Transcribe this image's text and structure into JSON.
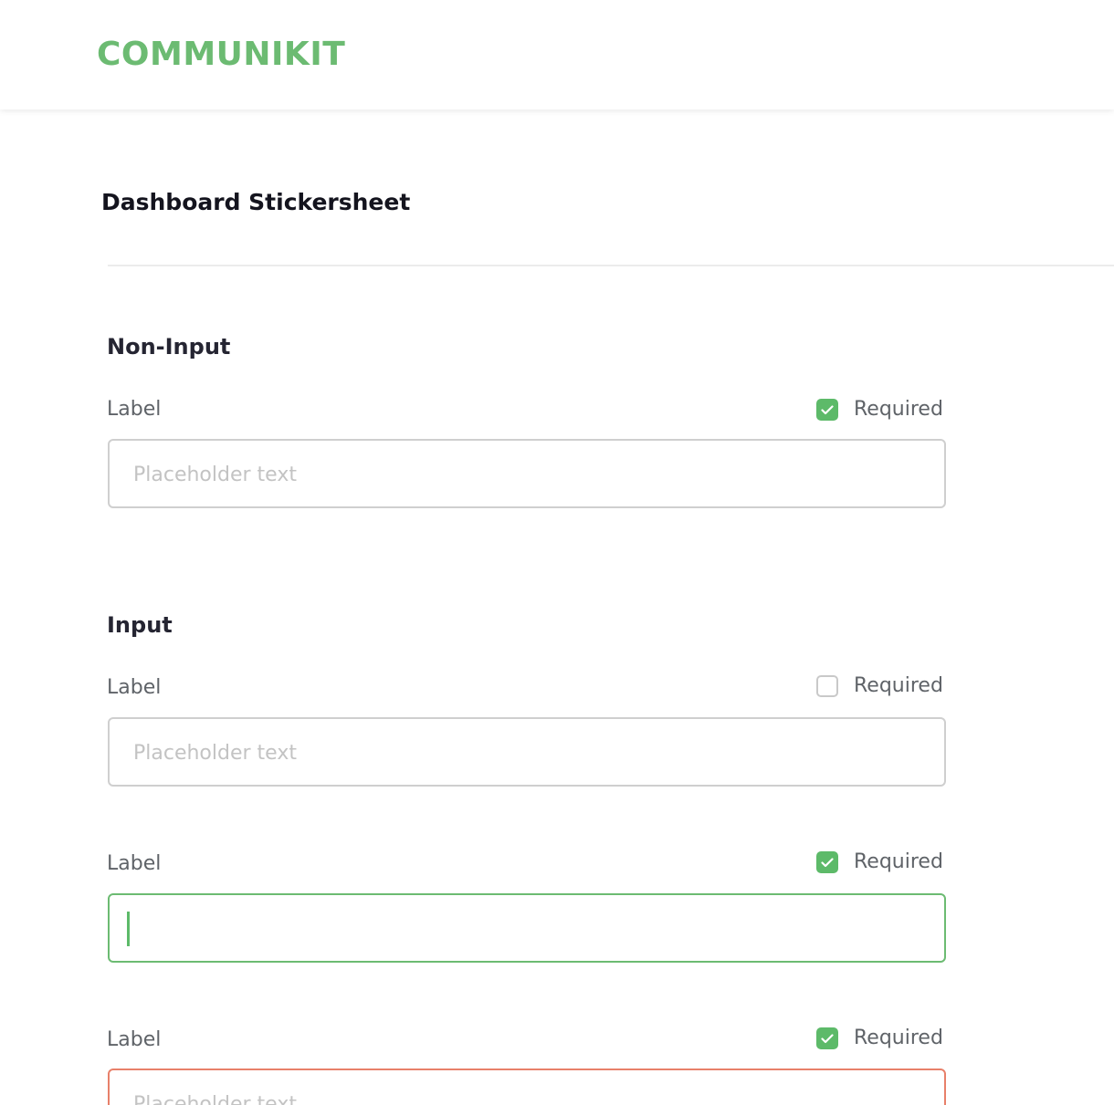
{
  "brand": {
    "name": "COMMUNIKIT",
    "color": "#6cbb72"
  },
  "page_title": "Dashboard Stickersheet",
  "sections": [
    {
      "heading": "Non-Input",
      "fields": [
        {
          "label": "Label",
          "required_label": "Required",
          "required_checked": true,
          "placeholder": "Placeholder text",
          "state": "default"
        }
      ]
    },
    {
      "heading": "Input",
      "fields": [
        {
          "label": "Label",
          "required_label": "Required",
          "required_checked": false,
          "placeholder": "Placeholder text",
          "state": "default"
        },
        {
          "label": "Label",
          "required_label": "Required",
          "required_checked": true,
          "placeholder": "",
          "state": "focus"
        },
        {
          "label": "Label",
          "required_label": "Required",
          "required_checked": true,
          "placeholder": "Placeholder text",
          "state": "error"
        }
      ]
    }
  ],
  "colors": {
    "accent": "#6cbb72",
    "checkbox_checked": "#5dba69",
    "input_border": "#cfcfcf",
    "error_border": "#e8806a"
  },
  "icons": {
    "check": "check-icon"
  }
}
